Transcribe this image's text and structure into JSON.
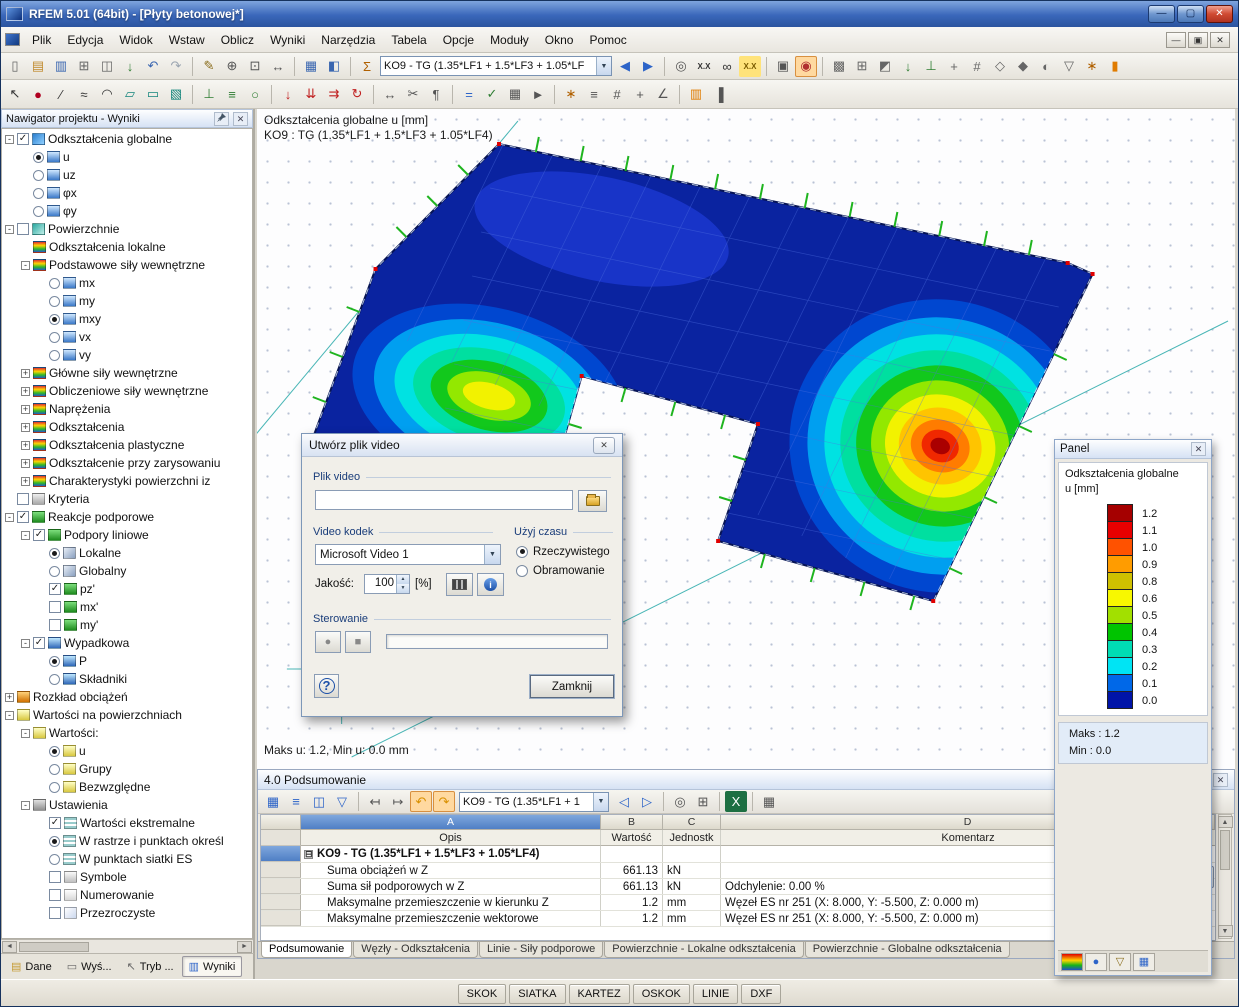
{
  "window": {
    "title": "RFEM 5.01 (64bit) - [Płyty betonowej*]",
    "buttons": {
      "minimize": "—",
      "maximize": "▢",
      "close": "✕"
    }
  },
  "icons": {
    "check": "✓",
    "close": "✕",
    "restore": "▣",
    "minimize": "—",
    "dropdown": "▼",
    "spin_up": "▲",
    "spin_down": "▼",
    "arrow_up": "▲",
    "arrow_down": "▼",
    "arrow_left": "◄",
    "arrow_right": "►",
    "record": "●",
    "stop": "■",
    "help": "?",
    "info": "i",
    "collapse": "⊟"
  },
  "menu": {
    "items": [
      "Plik",
      "Edycja",
      "Widok",
      "Wstaw",
      "Oblicz",
      "Wyniki",
      "Narzędzia",
      "Tabela",
      "Opcje",
      "Moduły",
      "Okno",
      "Pomoc"
    ]
  },
  "toolbar1": {
    "combo_value": "KO9 - TG  (1.35*LF1 + 1.5*LF3 + 1.05*LF",
    "icons_left": [
      {
        "n": "new-file",
        "g": "▯",
        "c": "#666"
      },
      {
        "n": "open-project",
        "g": "▤",
        "c": "#c08a2d"
      },
      {
        "n": "save",
        "g": "▥",
        "c": "#3a66b0"
      },
      {
        "n": "print",
        "g": "⊞",
        "c": "#666"
      },
      {
        "n": "copy",
        "g": "◫",
        "c": "#666"
      },
      {
        "n": "export",
        "g": "↓",
        "c": "#2e7d32"
      },
      {
        "n": "undo",
        "g": "↶",
        "c": "#3a66b0"
      },
      {
        "n": "redo",
        "g": "↷",
        "c": "#9aa4b0"
      },
      {
        "sep": 1
      },
      {
        "n": "edit-pen",
        "g": "✎",
        "c": "#8a6d1d"
      },
      {
        "n": "zoom-in",
        "g": "⊕",
        "c": "#555"
      },
      {
        "n": "zoom-window",
        "g": "⊡",
        "c": "#555"
      },
      {
        "n": "pan",
        "g": "↔",
        "c": "#555"
      },
      {
        "sep": 1
      },
      {
        "n": "table-view",
        "g": "▦",
        "c": "#3a66b0"
      },
      {
        "n": "table-split",
        "g": "◧",
        "c": "#3a66b0"
      },
      {
        "sep": 1
      },
      {
        "n": "results-sum",
        "g": "Σ",
        "c": "#b06000"
      }
    ],
    "icons_right": [
      {
        "n": "case-prev",
        "g": "◀",
        "c": "#2d64c8"
      },
      {
        "n": "case-next",
        "g": "▶",
        "c": "#2d64c8"
      },
      {
        "sep": 1
      },
      {
        "n": "search",
        "g": "◎",
        "c": "#555"
      },
      {
        "n": "extreme-values",
        "g": "X.X",
        "c": "#333",
        "txt": 1
      },
      {
        "n": "show-results",
        "g": "∞",
        "c": "#333"
      },
      {
        "n": "values-highlight",
        "g": "X.X",
        "c": "#7a5b00",
        "txt": 1,
        "bg": "#ffe37a"
      },
      {
        "sep": 1
      },
      {
        "n": "snapshot",
        "g": "▣",
        "c": "#555"
      },
      {
        "n": "video-record",
        "g": "◉",
        "c": "#b03030",
        "on": 1
      },
      {
        "sep": 1
      },
      {
        "n": "display-grid",
        "g": "▩",
        "c": "#666"
      },
      {
        "n": "fe-mesh",
        "g": "⊞",
        "c": "#666"
      },
      {
        "n": "render-mode",
        "g": "◩",
        "c": "#666"
      },
      {
        "n": "loads-display",
        "g": "↓",
        "c": "#2e7d32"
      },
      {
        "n": "supports-display",
        "g": "⊥",
        "c": "#2e7d32"
      },
      {
        "n": "axes-display",
        "g": "+",
        "c": "#666"
      },
      {
        "n": "numbering-display",
        "g": "#",
        "c": "#666"
      },
      {
        "n": "isometric-view",
        "g": "◇",
        "c": "#666"
      },
      {
        "n": "perspective-view",
        "g": "◆",
        "c": "#666"
      },
      {
        "n": "visibility",
        "g": "◐",
        "c": "#666"
      },
      {
        "n": "filter-objects",
        "g": "▽",
        "c": "#666"
      },
      {
        "n": "special-settings",
        "g": "∗",
        "c": "#b06000"
      },
      {
        "n": "panel-toggle",
        "g": "▮",
        "c": "#e07b00"
      }
    ]
  },
  "toolbar2": {
    "icons": [
      {
        "n": "select-arrow",
        "g": "↖",
        "c": "#333"
      },
      {
        "n": "new-node",
        "g": "●",
        "c": "#b00020"
      },
      {
        "n": "new-line",
        "g": "∕",
        "c": "#333"
      },
      {
        "n": "new-polyline",
        "g": "≈",
        "c": "#333"
      },
      {
        "n": "new-arc",
        "g": "◠",
        "c": "#333"
      },
      {
        "n": "new-surface",
        "g": "▱",
        "c": "#14857c"
      },
      {
        "n": "new-opening",
        "g": "▭",
        "c": "#14857c"
      },
      {
        "n": "new-solid",
        "g": "▧",
        "c": "#14857c"
      },
      {
        "sep": 1
      },
      {
        "n": "nodal-support",
        "g": "⊥",
        "c": "#2e7d32"
      },
      {
        "n": "line-support",
        "g": "≡",
        "c": "#2e7d32"
      },
      {
        "n": "hinge",
        "g": "○",
        "c": "#2e7d32"
      },
      {
        "sep": 1
      },
      {
        "n": "nodal-load",
        "g": "↓",
        "c": "#c02020"
      },
      {
        "n": "line-load",
        "g": "⇊",
        "c": "#c02020"
      },
      {
        "n": "surface-load",
        "g": "⇉",
        "c": "#c02020"
      },
      {
        "n": "moment-load",
        "g": "↻",
        "c": "#c02020"
      },
      {
        "sep": 1
      },
      {
        "n": "dimension",
        "g": "↔",
        "c": "#555"
      },
      {
        "n": "section",
        "g": "✂",
        "c": "#555"
      },
      {
        "n": "comment",
        "g": "¶",
        "c": "#555"
      },
      {
        "sep": 1
      },
      {
        "n": "calculate",
        "g": "=",
        "c": "#2d64c8"
      },
      {
        "n": "check-model",
        "g": "✓",
        "c": "#2e7d32"
      },
      {
        "n": "generate-mesh",
        "g": "▦",
        "c": "#555"
      },
      {
        "n": "animation",
        "g": "►",
        "c": "#555"
      },
      {
        "sep": 1
      },
      {
        "n": "configuration",
        "g": "∗",
        "c": "#b06000"
      },
      {
        "n": "layers",
        "g": "≡",
        "c": "#555"
      },
      {
        "n": "workplane",
        "g": "#",
        "c": "#555"
      },
      {
        "n": "snap-settings",
        "g": "+",
        "c": "#555"
      },
      {
        "n": "coordinate-system",
        "g": "∠",
        "c": "#555"
      },
      {
        "sep": 1
      },
      {
        "n": "color-panel",
        "g": "▥",
        "c": "#e07b00"
      },
      {
        "n": "side-panel",
        "g": "▐",
        "c": "#555"
      }
    ]
  },
  "navigator": {
    "title": "Nawigator projektu - Wyniki",
    "tree": [
      {
        "level": 0,
        "exp": "-",
        "ctrl": "check",
        "on": true,
        "icon": "deform",
        "label": "Odkształcenia globalne"
      },
      {
        "level": 1,
        "exp": "",
        "ctrl": "radio",
        "on": true,
        "icon": "result",
        "label": "u"
      },
      {
        "level": 1,
        "exp": "",
        "ctrl": "radio",
        "on": false,
        "icon": "result",
        "label": "uz"
      },
      {
        "level": 1,
        "exp": "",
        "ctrl": "radio",
        "on": false,
        "icon": "result",
        "label": "φx"
      },
      {
        "level": 1,
        "exp": "",
        "ctrl": "radio",
        "on": false,
        "icon": "result",
        "label": "φy"
      },
      {
        "level": 0,
        "exp": "-",
        "ctrl": "check",
        "on": false,
        "icon": "surface",
        "label": "Powierzchnie"
      },
      {
        "level": 1,
        "exp": "",
        "ctrl": "none",
        "on": false,
        "icon": "rainbow",
        "label": "Odkształcenia lokalne"
      },
      {
        "level": 1,
        "exp": "-",
        "ctrl": "none",
        "on": false,
        "icon": "rainbow",
        "label": "Podstawowe siły wewnętrzne"
      },
      {
        "level": 2,
        "exp": "",
        "ctrl": "radio",
        "on": false,
        "icon": "result",
        "label": "mx"
      },
      {
        "level": 2,
        "exp": "",
        "ctrl": "radio",
        "on": false,
        "icon": "result",
        "label": "my"
      },
      {
        "level": 2,
        "exp": "",
        "ctrl": "radio",
        "on": true,
        "icon": "result",
        "label": "mxy"
      },
      {
        "level": 2,
        "exp": "",
        "ctrl": "radio",
        "on": false,
        "icon": "result",
        "label": "vx"
      },
      {
        "level": 2,
        "exp": "",
        "ctrl": "radio",
        "on": false,
        "icon": "result",
        "label": "vy"
      },
      {
        "level": 1,
        "exp": "+",
        "ctrl": "none",
        "on": false,
        "icon": "rainbow",
        "label": "Główne siły wewnętrzne"
      },
      {
        "level": 1,
        "exp": "+",
        "ctrl": "none",
        "on": false,
        "icon": "rainbow",
        "label": "Obliczeniowe siły wewnętrzne"
      },
      {
        "level": 1,
        "exp": "+",
        "ctrl": "none",
        "on": false,
        "icon": "rainbow",
        "label": "Naprężenia"
      },
      {
        "level": 1,
        "exp": "+",
        "ctrl": "none",
        "on": false,
        "icon": "rainbow",
        "label": "Odkształcenia"
      },
      {
        "level": 1,
        "exp": "+",
        "ctrl": "none",
        "on": false,
        "icon": "rainbow",
        "label": "Odkształcenia plastyczne"
      },
      {
        "level": 1,
        "exp": "+",
        "ctrl": "none",
        "on": false,
        "icon": "rainbow",
        "label": "Odkształcenie przy zarysowaniu"
      },
      {
        "level": 1,
        "exp": "+",
        "ctrl": "none",
        "on": false,
        "icon": "rainbow",
        "label": "Charakterystyki powierzchni iz"
      },
      {
        "level": 0,
        "exp": "",
        "ctrl": "check",
        "on": false,
        "icon": "criteria",
        "label": "Kryteria"
      },
      {
        "level": 0,
        "exp": "-",
        "ctrl": "check",
        "on": true,
        "icon": "support",
        "label": "Reakcje podporowe"
      },
      {
        "level": 1,
        "exp": "-",
        "ctrl": "check",
        "on": true,
        "icon": "support",
        "label": "Podpory liniowe"
      },
      {
        "level": 2,
        "exp": "",
        "ctrl": "radio",
        "on": true,
        "icon": "axes",
        "label": "Lokalne"
      },
      {
        "level": 2,
        "exp": "",
        "ctrl": "radio",
        "on": false,
        "icon": "axes",
        "label": "Globalny"
      },
      {
        "level": 2,
        "exp": "",
        "ctrl": "check",
        "on": true,
        "icon": "support",
        "label": "pz'"
      },
      {
        "level": 2,
        "exp": "",
        "ctrl": "check",
        "on": false,
        "icon": "support",
        "label": "mx'"
      },
      {
        "level": 2,
        "exp": "",
        "ctrl": "check",
        "on": false,
        "icon": "support",
        "label": "my'"
      },
      {
        "level": 1,
        "exp": "-",
        "ctrl": "check",
        "on": true,
        "icon": "resultant",
        "label": "Wypadkowa"
      },
      {
        "level": 2,
        "exp": "",
        "ctrl": "radio",
        "on": true,
        "icon": "resultant",
        "label": "P"
      },
      {
        "level": 2,
        "exp": "",
        "ctrl": "radio",
        "on": false,
        "icon": "resultant",
        "label": "Składniki"
      },
      {
        "level": 0,
        "exp": "+",
        "ctrl": "none",
        "on": false,
        "icon": "load",
        "label": "Rozkład obciążeń"
      },
      {
        "level": 0,
        "exp": "-",
        "ctrl": "none",
        "on": false,
        "icon": "values",
        "label": "Wartości na powierzchniach"
      },
      {
        "level": 1,
        "exp": "-",
        "ctrl": "none",
        "on": false,
        "icon": "values",
        "label": "Wartości:"
      },
      {
        "level": 2,
        "exp": "",
        "ctrl": "radio",
        "on": true,
        "icon": "values",
        "label": "u"
      },
      {
        "level": 2,
        "exp": "",
        "ctrl": "radio",
        "on": false,
        "icon": "values",
        "label": "Grupy"
      },
      {
        "level": 2,
        "exp": "",
        "ctrl": "radio",
        "on": false,
        "icon": "values",
        "label": "Bezwzględne"
      },
      {
        "level": 1,
        "exp": "-",
        "ctrl": "none",
        "on": false,
        "icon": "settings",
        "label": "Ustawienia"
      },
      {
        "level": 2,
        "exp": "",
        "ctrl": "check",
        "on": true,
        "icon": "grid",
        "label": "Wartości ekstremalne"
      },
      {
        "level": 2,
        "exp": "",
        "ctrl": "radio",
        "on": true,
        "icon": "grid",
        "label": "W rastrze i punktach określ"
      },
      {
        "level": 2,
        "exp": "",
        "ctrl": "radio",
        "on": false,
        "icon": "grid",
        "label": "W punktach siatki ES"
      },
      {
        "level": 2,
        "exp": "",
        "ctrl": "check",
        "on": false,
        "icon": "symbols",
        "label": "Symbole"
      },
      {
        "level": 2,
        "exp": "",
        "ctrl": "check",
        "on": false,
        "icon": "numbering",
        "label": "Numerowanie"
      },
      {
        "level": 2,
        "exp": "",
        "ctrl": "check",
        "on": false,
        "icon": "transparent",
        "label": "Przezroczyste"
      }
    ]
  },
  "nav_tabs": [
    {
      "label": "Dane",
      "g": "▤",
      "c": "#c59a32",
      "active": false
    },
    {
      "label": "Wyś...",
      "g": "▭",
      "c": "#666666",
      "active": false
    },
    {
      "label": "Tryb ...",
      "g": "↖",
      "c": "#666666",
      "active": false
    },
    {
      "label": "Wyniki",
      "g": "▥",
      "c": "#2d64c8",
      "active": true
    }
  ],
  "viewport": {
    "header1": "Odkształcenia globalne u [mm]",
    "header2": "KO9 : TG  (1.35*LF1 + 1.5*LF3 + 1.05*LF4)",
    "status": "Maks u: 1.2, Min u: 0.0 mm"
  },
  "dialog": {
    "title": "Utwórz plik video",
    "file_caption": "Plik video",
    "codec_caption": "Video kodek",
    "codec_value": "Microsoft Video 1",
    "quality_label": "Jakość:",
    "quality_value": "100",
    "quality_unit": "[%]",
    "time_caption": "Użyj czasu",
    "time_options": [
      {
        "label": "Rzeczywistego",
        "selected": true
      },
      {
        "label": "Obramowanie",
        "selected": false
      }
    ],
    "control_caption": "Sterowanie",
    "close_label": "Zamknij"
  },
  "panel": {
    "title": "Panel",
    "subtitle1": "Odkształcenia globalne",
    "subtitle2": "u [mm]",
    "scale": [
      {
        "value": "1.2",
        "color": "#a50000"
      },
      {
        "value": "1.1",
        "color": "#e80000"
      },
      {
        "value": "1.0",
        "color": "#ff5200"
      },
      {
        "value": "0.9",
        "color": "#ff9c00"
      },
      {
        "value": "0.8",
        "color": "#cfc000"
      },
      {
        "value": "0.6",
        "color": "#f8f800"
      },
      {
        "value": "0.5",
        "color": "#a2e000"
      },
      {
        "value": "0.4",
        "color": "#00c400"
      },
      {
        "value": "0.3",
        "color": "#00dcb4"
      },
      {
        "value": "0.2",
        "color": "#00e4f4"
      },
      {
        "value": "0.1",
        "color": "#0068e8"
      },
      {
        "value": "0.0",
        "color": "#0014a8"
      }
    ],
    "maks": "Maks : 1.2",
    "min": "Min :  0.0",
    "tabs": [
      {
        "n": "color-scale",
        "g": "▥",
        "rainbow": true
      },
      {
        "n": "factors",
        "g": "●",
        "c": "#2d64c8"
      },
      {
        "n": "filter",
        "g": "▽",
        "c": "#8a6d1d"
      },
      {
        "n": "display",
        "g": "▦",
        "c": "#2d64c8"
      }
    ]
  },
  "table": {
    "title": "4.0 Podsumowanie",
    "combo_value": "KO9 - TG (1.35*LF1 + 1",
    "letters": [
      "A",
      "B",
      "C",
      "D"
    ],
    "headers": [
      "Opis",
      "Wartość",
      "Jednostk",
      "Komentarz"
    ],
    "group_row": "KO9 - TG  (1.35*LF1 + 1.5*LF3 + 1.05*LF4)",
    "rows": [
      {
        "opis": "Suma obciążeń w Z",
        "wartosc": "661.13",
        "jedn": "kN",
        "koment": ""
      },
      {
        "opis": "Suma sił podporowych w Z",
        "wartosc": "661.13",
        "jedn": "kN",
        "koment": "Odchylenie: 0.00 %"
      },
      {
        "opis": "Maksymalne przemieszczenie w kierunku Z",
        "wartosc": "1.2",
        "jedn": "mm",
        "koment": "Węzeł ES nr 251  (X: 8.000, Y: -5.500, Z: 0.000 m)"
      },
      {
        "opis": "Maksymalne przemieszczenie wektorowe",
        "wartosc": "1.2",
        "jedn": "mm",
        "koment": "Węzeł ES nr 251  (X: 8.000, Y: -5.500, Z: 0.000 m)"
      }
    ],
    "tabs": [
      "Podsumowanie",
      "Węzły - Odkształcenia",
      "Linie - Siły podporowe",
      "Powierzchnie - Lokalne odkształcenia",
      "Powierzchnie - Globalne odkształcenia"
    ],
    "icons_left": [
      {
        "n": "table-settings",
        "g": "▦",
        "c": "#2d64c8"
      },
      {
        "n": "table-rows",
        "g": "≡",
        "c": "#2d64c8"
      },
      {
        "n": "table-columns",
        "g": "◫",
        "c": "#2d64c8"
      },
      {
        "n": "table-filter",
        "g": "▽",
        "c": "#2d64c8"
      },
      {
        "sep": 1
      },
      {
        "n": "table-to-start",
        "g": "↤",
        "c": "#555"
      },
      {
        "n": "table-to-end",
        "g": "↦",
        "c": "#555"
      },
      {
        "n": "table-undo",
        "g": "↶",
        "c": "#d99000",
        "on": 1
      },
      {
        "n": "table-redo",
        "g": "↷",
        "c": "#d99000",
        "on": 1
      }
    ],
    "icons_right": [
      {
        "n": "table-case-prev",
        "g": "◁",
        "c": "#2d64c8"
      },
      {
        "n": "table-case-next",
        "g": "▷",
        "c": "#2d64c8"
      },
      {
        "sep": 1
      },
      {
        "n": "table-search",
        "g": "◎",
        "c": "#555"
      },
      {
        "n": "table-print",
        "g": "⊞",
        "c": "#555"
      },
      {
        "sep": 1
      },
      {
        "n": "excel-export",
        "g": "X",
        "c": "#ffffff",
        "bg": "#1d6f42"
      },
      {
        "sep": 1
      },
      {
        "n": "calculator",
        "g": "▦",
        "c": "#555"
      }
    ]
  },
  "statusbar": {
    "buttons": [
      "SKOK",
      "SIATKA",
      "KARTEZ",
      "OSKOK",
      "LINIE",
      "DXF"
    ]
  }
}
